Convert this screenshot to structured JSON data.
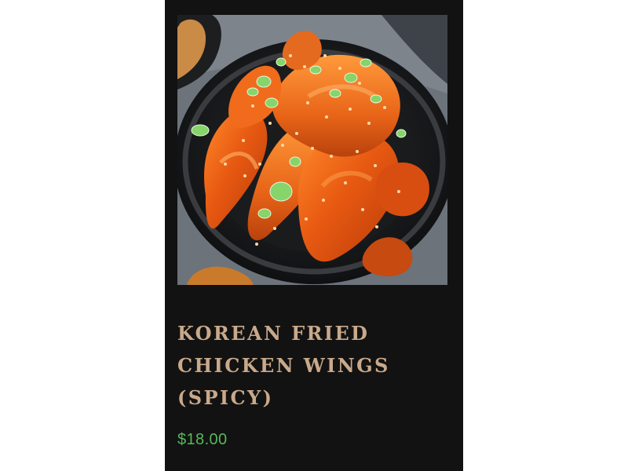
{
  "product": {
    "image_alt": "Korean fried chicken wings in a black bowl",
    "title": "KOREAN FRIED CHICKEN WINGS (SPICY)",
    "price": "$18.00"
  },
  "colors": {
    "card_background": "#121212",
    "title_color": "#c9a98b",
    "price_color": "#57b85a"
  },
  "icons": {
    "product_photo": "food-photo"
  }
}
